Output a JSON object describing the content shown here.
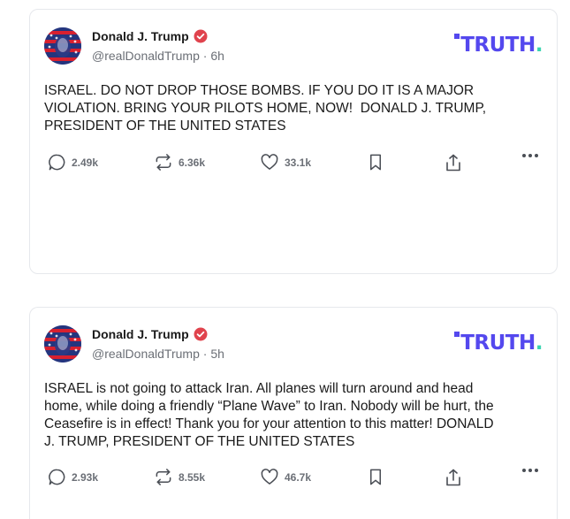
{
  "posts": [
    {
      "author": "Donald J. Trump",
      "handle": "@realDonaldTrump",
      "separator": "·",
      "time": "6h",
      "logo": "TRUTH",
      "logo_dot": ".",
      "text": "ISRAEL. DO NOT DROP THOSE BOMBS. IF YOU DO IT IS A MAJOR\nVIOLATION. BRING YOUR PILOTS HOME, NOW!  DONALD J. TRUMP,\nPRESIDENT OF THE UNITED STATES",
      "replies": "2.49k",
      "retruths": "6.36k",
      "likes": "33.1k"
    },
    {
      "author": "Donald J. Trump",
      "handle": "@realDonaldTrump",
      "separator": "·",
      "time": "5h",
      "logo": "TRUTH",
      "logo_dot": ".",
      "text": "ISRAEL is not going to attack Iran. All planes will turn around and head\nhome, while doing a friendly “Plane Wave” to Iran. Nobody will be hurt, the\nCeasefire is in effect! Thank you for your attention to this matter! DONALD\nJ. TRUMP, PRESIDENT OF THE UNITED STATES",
      "replies": "2.93k",
      "retruths": "8.55k",
      "likes": "46.7k"
    }
  ],
  "icons": {
    "verified": "verified-badge-icon",
    "reply": "speech-bubble-icon",
    "retruth": "repost-arrows-icon",
    "like": "heart-icon",
    "bookmark": "bookmark-icon",
    "share": "share-upload-icon",
    "more": "ellipsis-icon"
  },
  "colors": {
    "brand": "#5448ee",
    "brand_dot": "#3ad4b0",
    "verified": "#e0434d",
    "muted": "#6b6f76"
  }
}
